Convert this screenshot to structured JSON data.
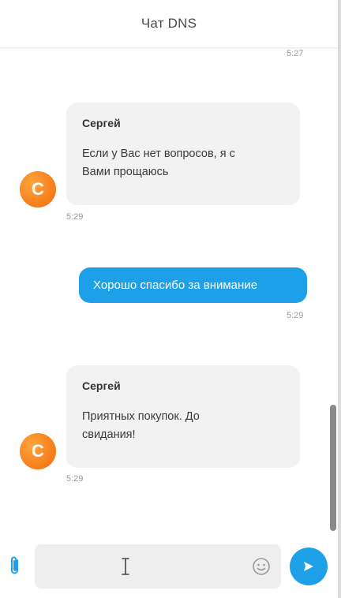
{
  "header": {
    "title": "Чат DNS"
  },
  "messages": {
    "top_time": "5:27",
    "m1": {
      "avatar_letter": "С",
      "sender": "Сергей",
      "text_line1": "Если у Вас нет вопросов, я с",
      "text_line2": "Вами прощаюсь",
      "time": "5:29"
    },
    "m2": {
      "text": "Хорошо спасибо за внимание",
      "time": "5:29"
    },
    "m3": {
      "avatar_letter": "С",
      "sender": "Сергей",
      "text_line1": "Приятных покупок. До",
      "text_line2": "свидания!",
      "time": "5:29"
    }
  },
  "composer": {
    "input_value": "",
    "attach_icon": "paperclip-icon",
    "emoji_icon": "smiley-icon",
    "send_icon": "send-icon"
  },
  "colors": {
    "accent": "#1ea0e8",
    "avatar": "#f7841f",
    "bubble_in": "#f2f2f2"
  }
}
